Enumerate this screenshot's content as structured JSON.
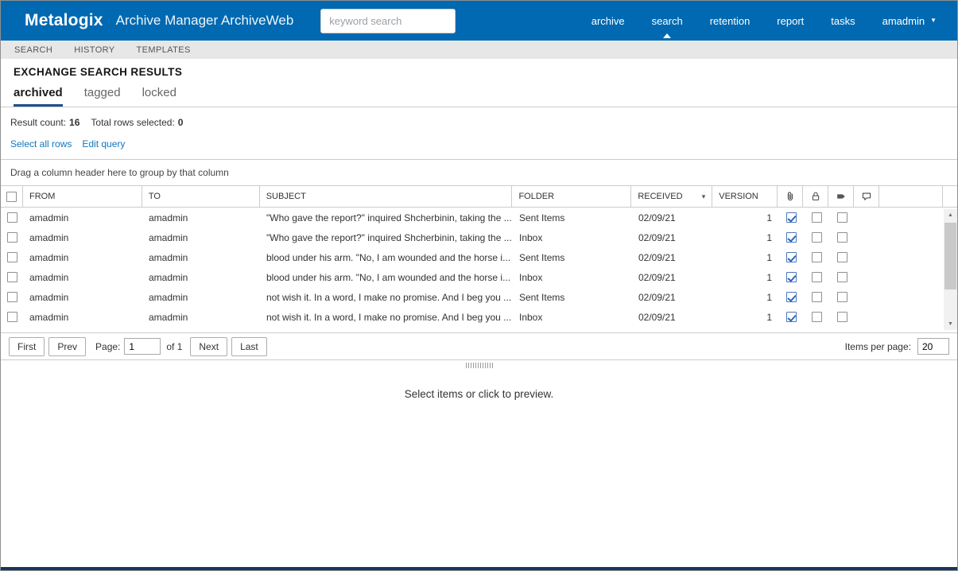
{
  "colors": {
    "topbar_bg": "#0069b1",
    "active_tab_underline": "#1d4f91",
    "link": "#1177bb",
    "window_bottom_bar": "#17355f",
    "checkbox_check": "#2b66c2"
  },
  "topbar": {
    "brand": "Metalogix",
    "app_title": "Archive Manager ArchiveWeb",
    "search_placeholder": "keyword search",
    "nav": [
      "archive",
      "search",
      "retention",
      "report",
      "tasks"
    ],
    "user": "amadmin"
  },
  "subnav": [
    "SEARCH",
    "HISTORY",
    "TEMPLATES"
  ],
  "page_title": "EXCHANGE SEARCH RESULTS",
  "result_tabs": [
    "archived",
    "tagged",
    "locked"
  ],
  "summary": {
    "result_count_label": "Result count:",
    "result_count": "16",
    "rows_selected_label": "Total rows selected:",
    "rows_selected": "0"
  },
  "links": {
    "select_all": "Select all rows",
    "edit_query": "Edit query"
  },
  "grouping_hint": "Drag a column header here to group by that column",
  "table": {
    "columns": [
      "FROM",
      "TO",
      "SUBJECT",
      "FOLDER",
      "RECEIVED",
      "VERSION"
    ],
    "icon_columns": [
      "attachment",
      "lock",
      "tag",
      "comment"
    ],
    "rows": [
      {
        "selected": false,
        "from": "amadmin",
        "to": "amadmin",
        "subject": "\"Who gave the report?\" inquired Shcherbinin, taking the ...",
        "folder": "Sent Items",
        "received": "02/09/21",
        "version": "1",
        "attachment": true,
        "locked": false,
        "tagged": false,
        "commented": false
      },
      {
        "selected": false,
        "from": "amadmin",
        "to": "amadmin",
        "subject": "\"Who gave the report?\" inquired Shcherbinin, taking the ...",
        "folder": "Inbox",
        "received": "02/09/21",
        "version": "1",
        "attachment": true,
        "locked": false,
        "tagged": false,
        "commented": false
      },
      {
        "selected": false,
        "from": "amadmin",
        "to": "amadmin",
        "subject": "blood under his arm. \"No, I am wounded and the horse i...",
        "folder": "Sent Items",
        "received": "02/09/21",
        "version": "1",
        "attachment": true,
        "locked": false,
        "tagged": false,
        "commented": false
      },
      {
        "selected": false,
        "from": "amadmin",
        "to": "amadmin",
        "subject": "blood under his arm. \"No, I am wounded and the horse i...",
        "folder": "Inbox",
        "received": "02/09/21",
        "version": "1",
        "attachment": true,
        "locked": false,
        "tagged": false,
        "commented": false
      },
      {
        "selected": false,
        "from": "amadmin",
        "to": "amadmin",
        "subject": "not wish it. In a word, I make no promise. And I beg you ...",
        "folder": "Sent Items",
        "received": "02/09/21",
        "version": "1",
        "attachment": true,
        "locked": false,
        "tagged": false,
        "commented": false
      },
      {
        "selected": false,
        "from": "amadmin",
        "to": "amadmin",
        "subject": "not wish it. In a word, I make no promise. And I beg you ...",
        "folder": "Inbox",
        "received": "02/09/21",
        "version": "1",
        "attachment": true,
        "locked": false,
        "tagged": false,
        "commented": false
      }
    ]
  },
  "pager": {
    "first": "First",
    "prev": "Prev",
    "page_label": "Page:",
    "page": "1",
    "of": "of 1",
    "next": "Next",
    "last": "Last",
    "items_per_page_label": "Items per page:",
    "items_per_page": "20"
  },
  "preview_placeholder": "Select items or click to preview."
}
